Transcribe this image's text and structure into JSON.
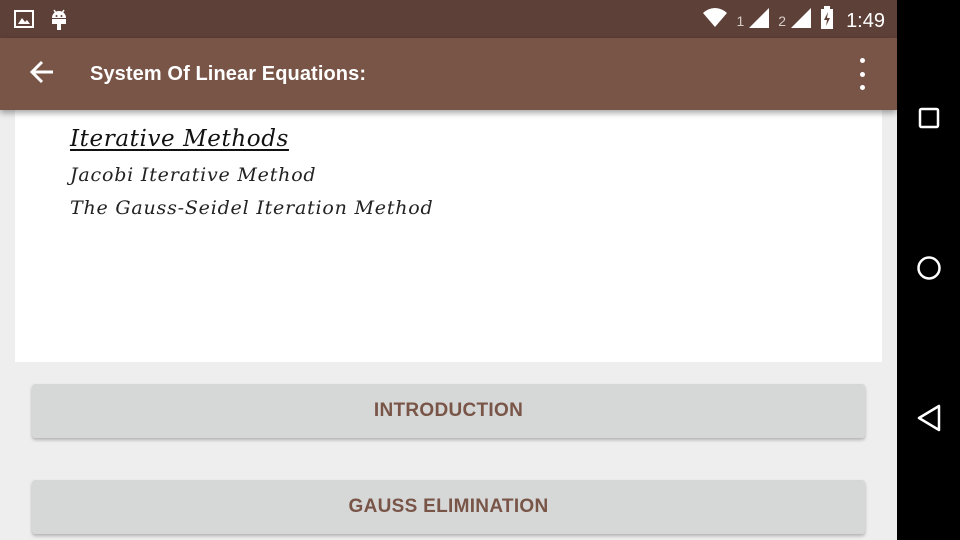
{
  "status_bar": {
    "icons_left": [
      "image-icon",
      "android-icon"
    ],
    "sim1_label": "1",
    "sim2_label": "2",
    "time": "1:49"
  },
  "app_bar": {
    "title": "System Of Linear Equations:",
    "back_icon": "arrow-left-icon",
    "menu_icon": "more-vert-icon"
  },
  "content": {
    "heading": "Iterative Methods",
    "items": [
      "Jacobi Iterative Method",
      "The Gauss-Seidel Iteration Method"
    ]
  },
  "buttons": {
    "introduction": "INTRODUCTION",
    "gauss_elimination": "GAUSS ELIMINATION"
  },
  "colors": {
    "status_bar": "#5d4037",
    "app_bar": "#795548",
    "button_bg": "#d6d7d7",
    "button_text": "#795548"
  }
}
